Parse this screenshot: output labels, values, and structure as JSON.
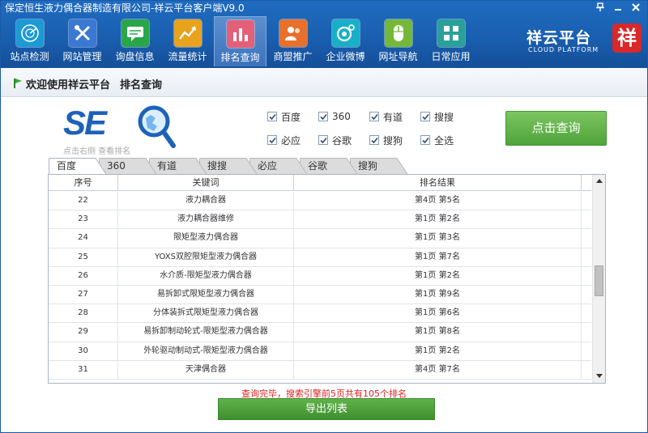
{
  "window": {
    "title": "保定恒生液力偶合器制造有限公司-祥云平台客户端V9.0",
    "controls": [
      {
        "name": "pin-icon"
      },
      {
        "name": "minimize-icon"
      },
      {
        "name": "close-icon"
      }
    ]
  },
  "toolbar": {
    "items": [
      {
        "label": "站点检测",
        "icon": "radar-icon",
        "color": "#1b9ad6"
      },
      {
        "label": "网站管理",
        "icon": "tools-icon",
        "color": "#3a78d4"
      },
      {
        "label": "询盘信息",
        "icon": "message-icon",
        "color": "#2aa64a"
      },
      {
        "label": "流量统计",
        "icon": "trend-icon",
        "color": "#e8a21c"
      },
      {
        "label": "排名查询",
        "icon": "bar-chart-icon",
        "color": "#e45f78"
      },
      {
        "label": "商盟推广",
        "icon": "users-icon",
        "color": "#e8702a"
      },
      {
        "label": "企业微博",
        "icon": "weibo-icon",
        "color": "#18b0c8"
      },
      {
        "label": "网址导航",
        "icon": "mouse-icon",
        "color": "#74b83a"
      },
      {
        "label": "日常应用",
        "icon": "grid-icon",
        "color": "#2aa09a"
      }
    ],
    "active_index": 4
  },
  "brand": {
    "name": "祥云平台",
    "subtitle": "CLOUD PLATFORM",
    "seal": "祥"
  },
  "welcome": {
    "greeting": "欢迎使用祥云平台",
    "page": "排名查询"
  },
  "seo": {
    "logo_text": "SE",
    "hint": "点击右侧 查看排名"
  },
  "engines": [
    {
      "label": "百度",
      "checked": true
    },
    {
      "label": "360",
      "checked": true
    },
    {
      "label": "有道",
      "checked": true
    },
    {
      "label": "搜搜",
      "checked": true
    },
    {
      "label": "必应",
      "checked": true
    },
    {
      "label": "谷歌",
      "checked": true
    },
    {
      "label": "搜狗",
      "checked": true
    },
    {
      "label": "全选",
      "checked": true
    }
  ],
  "query_button": "点击查询",
  "tabs": [
    {
      "label": "百度",
      "active": true
    },
    {
      "label": "360",
      "active": false
    },
    {
      "label": "有道",
      "active": false
    },
    {
      "label": "搜搜",
      "active": false
    },
    {
      "label": "必应",
      "active": false
    },
    {
      "label": "谷歌",
      "active": false
    },
    {
      "label": "搜狗",
      "active": false
    }
  ],
  "table": {
    "columns": [
      "序号",
      "关键词",
      "排名结果"
    ],
    "rows": [
      {
        "no": "22",
        "keyword": "液力耦合器",
        "result": "第4页 第5名"
      },
      {
        "no": "23",
        "keyword": "液力耦合器维修",
        "result": "第1页 第2名"
      },
      {
        "no": "24",
        "keyword": "限矩型液力偶合器",
        "result": "第1页 第3名"
      },
      {
        "no": "25",
        "keyword": "YOXS双腔限矩型液力偶合器",
        "result": "第1页 第7名"
      },
      {
        "no": "26",
        "keyword": "水介质-限矩型液力偶合器",
        "result": "第1页 第2名"
      },
      {
        "no": "27",
        "keyword": "易拆卸式限矩型液力偶合器",
        "result": "第1页 第9名"
      },
      {
        "no": "28",
        "keyword": "分体装拆式限矩型液力偶合器",
        "result": "第1页 第6名"
      },
      {
        "no": "29",
        "keyword": "易拆卸制动轮式-限矩型液力偶合器",
        "result": "第1页 第8名"
      },
      {
        "no": "30",
        "keyword": "外轮驱动制动式-限矩型液力偶合器",
        "result": "第1页 第2名"
      },
      {
        "no": "31",
        "keyword": "天津偶合器",
        "result": "第4页 第7名"
      }
    ],
    "scroll_position": 0.52
  },
  "status": "查询完毕，搜索引擎前5页共有105个排名",
  "export_button": "导出列表"
}
